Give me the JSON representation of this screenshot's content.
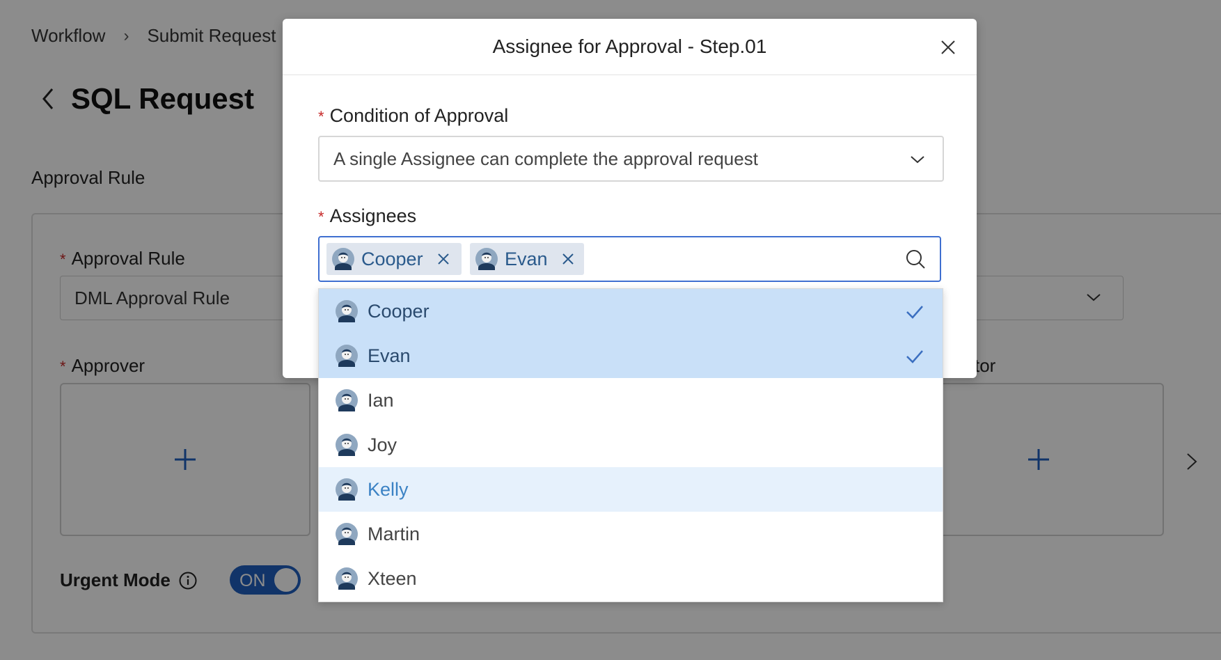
{
  "breadcrumb": [
    "Workflow",
    "Submit Request"
  ],
  "page_title": "SQL Request",
  "section_title": "Approval Rule",
  "form": {
    "approval_rule_label": "Approval Rule",
    "approval_rule_value": "DML Approval Rule",
    "approver_label": "Approver",
    "executor_label_fragment": "tor",
    "urgent_mode_label": "Urgent Mode",
    "urgent_toggle": "ON"
  },
  "modal": {
    "title": "Assignee for Approval - Step.01",
    "condition_label": "Condition of Approval",
    "condition_value": "A single Assignee can complete the approval request",
    "assignees_label": "Assignees",
    "selected_tags": [
      "Cooper",
      "Evan"
    ]
  },
  "options": [
    {
      "name": "Cooper",
      "selected": true
    },
    {
      "name": "Evan",
      "selected": true
    },
    {
      "name": "Ian",
      "selected": false
    },
    {
      "name": "Joy",
      "selected": false
    },
    {
      "name": "Kelly",
      "selected": false,
      "hovered": true
    },
    {
      "name": "Martin",
      "selected": false
    },
    {
      "name": "Xteen",
      "selected": false
    }
  ],
  "colors": {
    "primary": "#1f5fbf",
    "selected_row": "#c9e0f8",
    "hover_row": "#e6f1fc",
    "required": "#c62828"
  }
}
